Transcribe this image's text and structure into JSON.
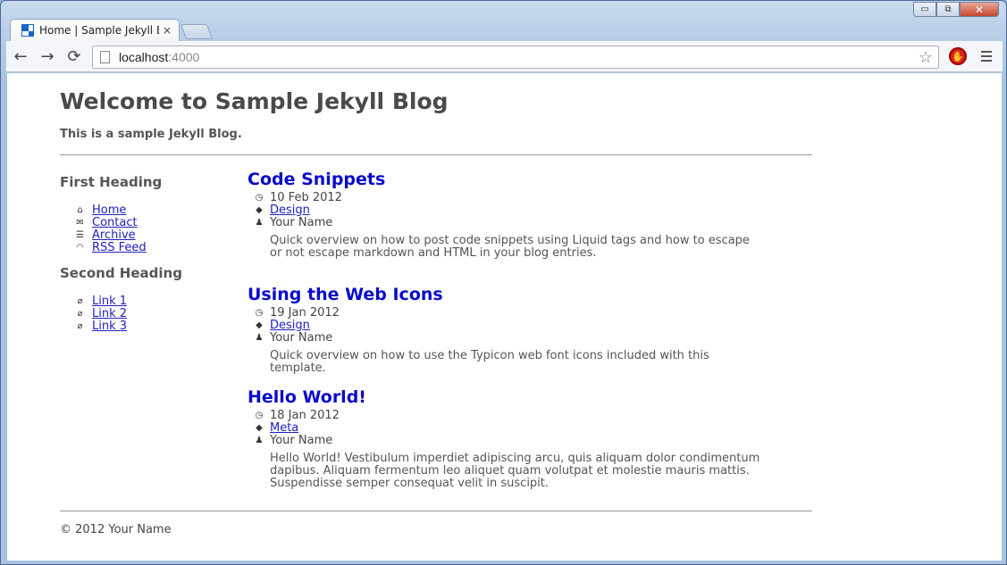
{
  "browser": {
    "tab_title": "Home | Sample Jekyll Blog",
    "tab_close": "×",
    "url_host": "localhost",
    "url_port": ":4000",
    "back_icon": "←",
    "forward_icon": "→",
    "reload_icon": "⟳",
    "star_icon": "☆",
    "window_minimize": "▭",
    "window_maximize": "⧉",
    "window_close": "✕"
  },
  "site": {
    "title": "Welcome to Sample Jekyll Blog",
    "description": "This is a sample Jekyll Blog."
  },
  "sidebar": {
    "first_heading": "First Heading",
    "nav": [
      {
        "icon": "home-icon",
        "glyph": "⌂",
        "label": "Home"
      },
      {
        "icon": "mail-icon",
        "glyph": "✉",
        "label": "Contact"
      },
      {
        "icon": "list-icon",
        "glyph": "☰",
        "label": "Archive"
      },
      {
        "icon": "rss-icon",
        "glyph": "◠",
        "label": "RSS Feed"
      }
    ],
    "second_heading": "Second Heading",
    "links": [
      {
        "icon": "link-icon",
        "glyph": "⌀",
        "label": "Link 1"
      },
      {
        "icon": "link-icon",
        "glyph": "⌀",
        "label": "Link 2"
      },
      {
        "icon": "link-icon",
        "glyph": "⌀",
        "label": "Link 3"
      }
    ]
  },
  "posts": [
    {
      "title": "Code Snippets",
      "date": "10 Feb 2012",
      "tag": "Design",
      "author": "Your Name",
      "excerpt": "Quick overview on how to post code snippets using Liquid tags and how to escape or not escape markdown and HTML in your blog entries."
    },
    {
      "title": "Using the Web Icons",
      "date": "19 Jan 2012",
      "tag": "Design",
      "author": "Your Name",
      "excerpt": "Quick overview on how to use the Typicon web font icons included with this template."
    },
    {
      "title": "Hello World!",
      "date": "18 Jan 2012",
      "tag": "Meta",
      "author": "Your Name",
      "excerpt": "Hello World! Vestibulum imperdiet adipiscing arcu, quis aliquam dolor condimentum dapibus. Aliquam fermentum leo aliquet quam volutpat et molestie mauris mattis. Suspendisse semper consequat velit in suscipit."
    }
  ],
  "footer": {
    "text": "© 2012 Your Name"
  },
  "icons": {
    "clock": "◷",
    "tag": "◆",
    "user": "♟"
  }
}
